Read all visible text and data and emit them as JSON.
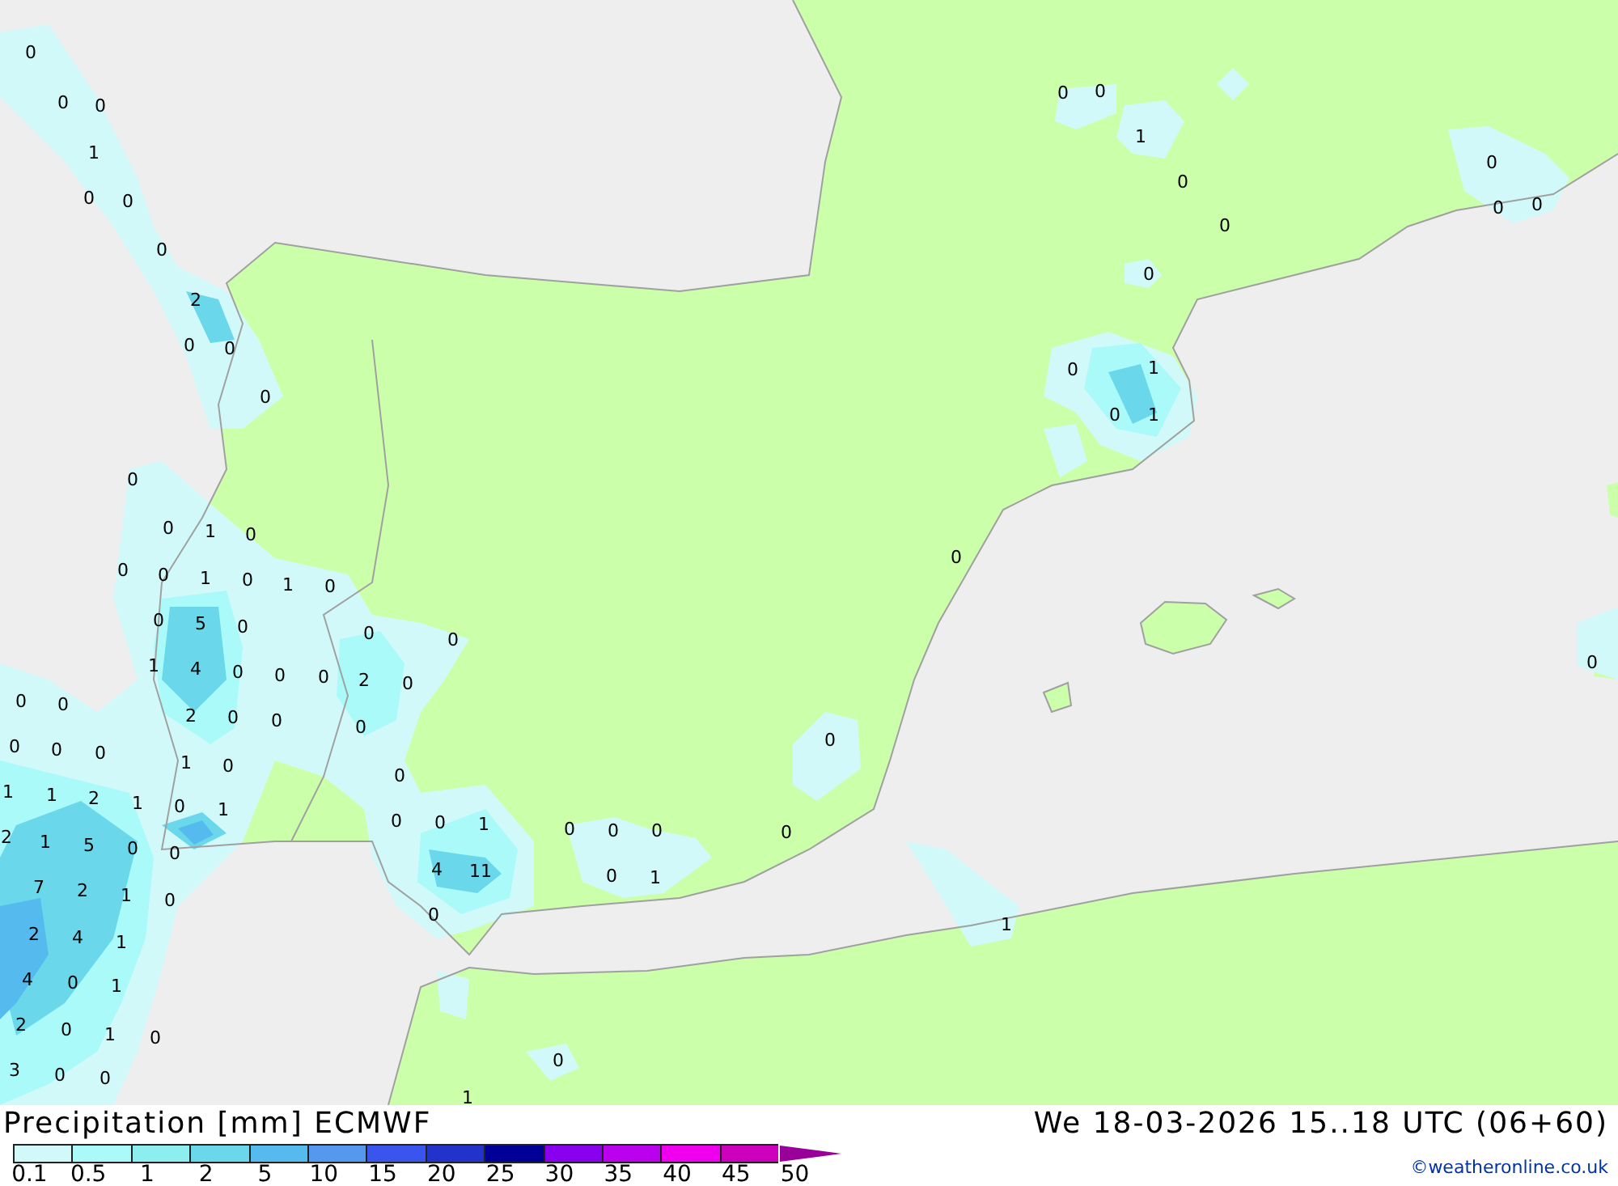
{
  "map": {
    "values": [
      "0",
      "0",
      "0",
      "1",
      "0",
      "0",
      "0",
      "2",
      "0",
      "0",
      "0",
      "0",
      "0",
      "1",
      "0",
      "0",
      "0",
      "1",
      "0",
      "1",
      "0",
      "0",
      "5",
      "0",
      "0",
      "0",
      "1",
      "4",
      "0",
      "0",
      "0",
      "2",
      "0",
      "0",
      "0",
      "2",
      "0",
      "0",
      "0",
      "0",
      "0",
      "0",
      "1",
      "0",
      "0",
      "1",
      "1",
      "2",
      "1",
      "0",
      "1",
      "0",
      "0",
      "1",
      "2",
      "1",
      "5",
      "0",
      "0",
      "4",
      "11",
      "7",
      "2",
      "1",
      "0",
      "0",
      "2",
      "4",
      "1",
      "4",
      "0",
      "1",
      "2",
      "0",
      "1",
      "0",
      "3",
      "0",
      "0",
      "1",
      "0",
      "0",
      "0",
      "0",
      "1",
      "0",
      "0",
      "0",
      "1",
      "0",
      "0",
      "0",
      "1",
      "0",
      "0",
      "0",
      "0",
      "1",
      "0",
      "1",
      "0",
      "0",
      "0",
      "0"
    ]
  },
  "title": "Precipitation [mm] ECMWF",
  "valid_time": "We 18-03-2026 15..18 UTC (06+60)",
  "legend": {
    "bands": [
      {
        "color": "#d2f9f9"
      },
      {
        "color": "#aafafa"
      },
      {
        "color": "#8ceeee"
      },
      {
        "color": "#6ad8ea"
      },
      {
        "color": "#55bbee"
      },
      {
        "color": "#5599ee"
      },
      {
        "color": "#3a55ee"
      },
      {
        "color": "#2233cc"
      },
      {
        "color": "#000099"
      },
      {
        "color": "#8800ee"
      },
      {
        "color": "#bb00ee"
      },
      {
        "color": "#ee00ee"
      },
      {
        "color": "#cc00bb"
      },
      {
        "color": "#990099"
      }
    ],
    "labels": [
      "0.1",
      "0.5",
      "1",
      "2",
      "5",
      "10",
      "15",
      "20",
      "25",
      "30",
      "35",
      "40",
      "45",
      "50"
    ]
  },
  "credit": "©weatheronline.co.uk"
}
